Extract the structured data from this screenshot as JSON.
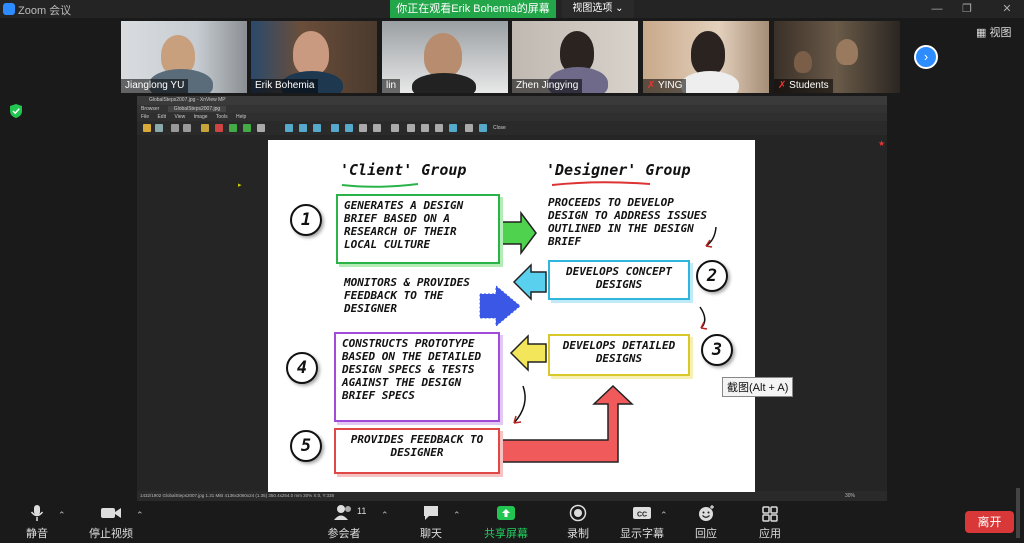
{
  "app": {
    "title": "Zoom 会议",
    "viewing_banner": "你正在观看Erik Bohemia的屏幕",
    "view_options": "视图选项 ⌄",
    "grid_view_label": "视图"
  },
  "participants": [
    {
      "name": "Jianglong YU"
    },
    {
      "name": "Erik Bohemia"
    },
    {
      "name": "lin"
    },
    {
      "name": "Zhen Jingying"
    },
    {
      "name": "YING"
    },
    {
      "name": "Students"
    }
  ],
  "shared_window": {
    "title": "GlobalSteps2007.jpg - XnView MP",
    "tabs": [
      "Browser",
      "GlobalSteps2007.jpg"
    ],
    "menu": [
      "File",
      "Edit",
      "View",
      "Image",
      "Tools",
      "Help"
    ],
    "toolbar_close": "Close",
    "status": "1432/1902   GlobalSteps2007.jpg   1.31 MiB   4136x3060x24 (1.35)   350.4x254.0 mm   30%   X:0, Y:338",
    "zoom": "30%"
  },
  "diagram": {
    "client_header": "'Client' Group",
    "designer_header": "'Designer' Group",
    "box1": "Generates a design brief based on a research of their local culture",
    "designer1": "Proceeds to develop design to address issues outlined in the design brief",
    "box2": "Develops concept designs",
    "monitors": "Monitors & provides feedback to the designer",
    "box3": "Develops detailed designs",
    "box4": "Constructs prototype based on the detailed design specs & tests against the design brief specs",
    "box5": "Provides feedback to designer",
    "n1": "1",
    "n2": "2",
    "n3": "3",
    "n4": "4",
    "n5": "5"
  },
  "tooltip": "截图(Alt + A)",
  "bottom_toolbar": {
    "mute": "静音",
    "stop_video": "停止视频",
    "participants": "参会者",
    "participant_count": "11",
    "chat": "聊天",
    "share": "共享屏幕",
    "record": "录制",
    "captions": "显示字幕",
    "reactions": "回应",
    "apps": "应用",
    "leave": "离开"
  },
  "colors": {
    "zoom_blue": "#2d8cff",
    "green": "#23a64a",
    "leave_red": "#d93838"
  }
}
